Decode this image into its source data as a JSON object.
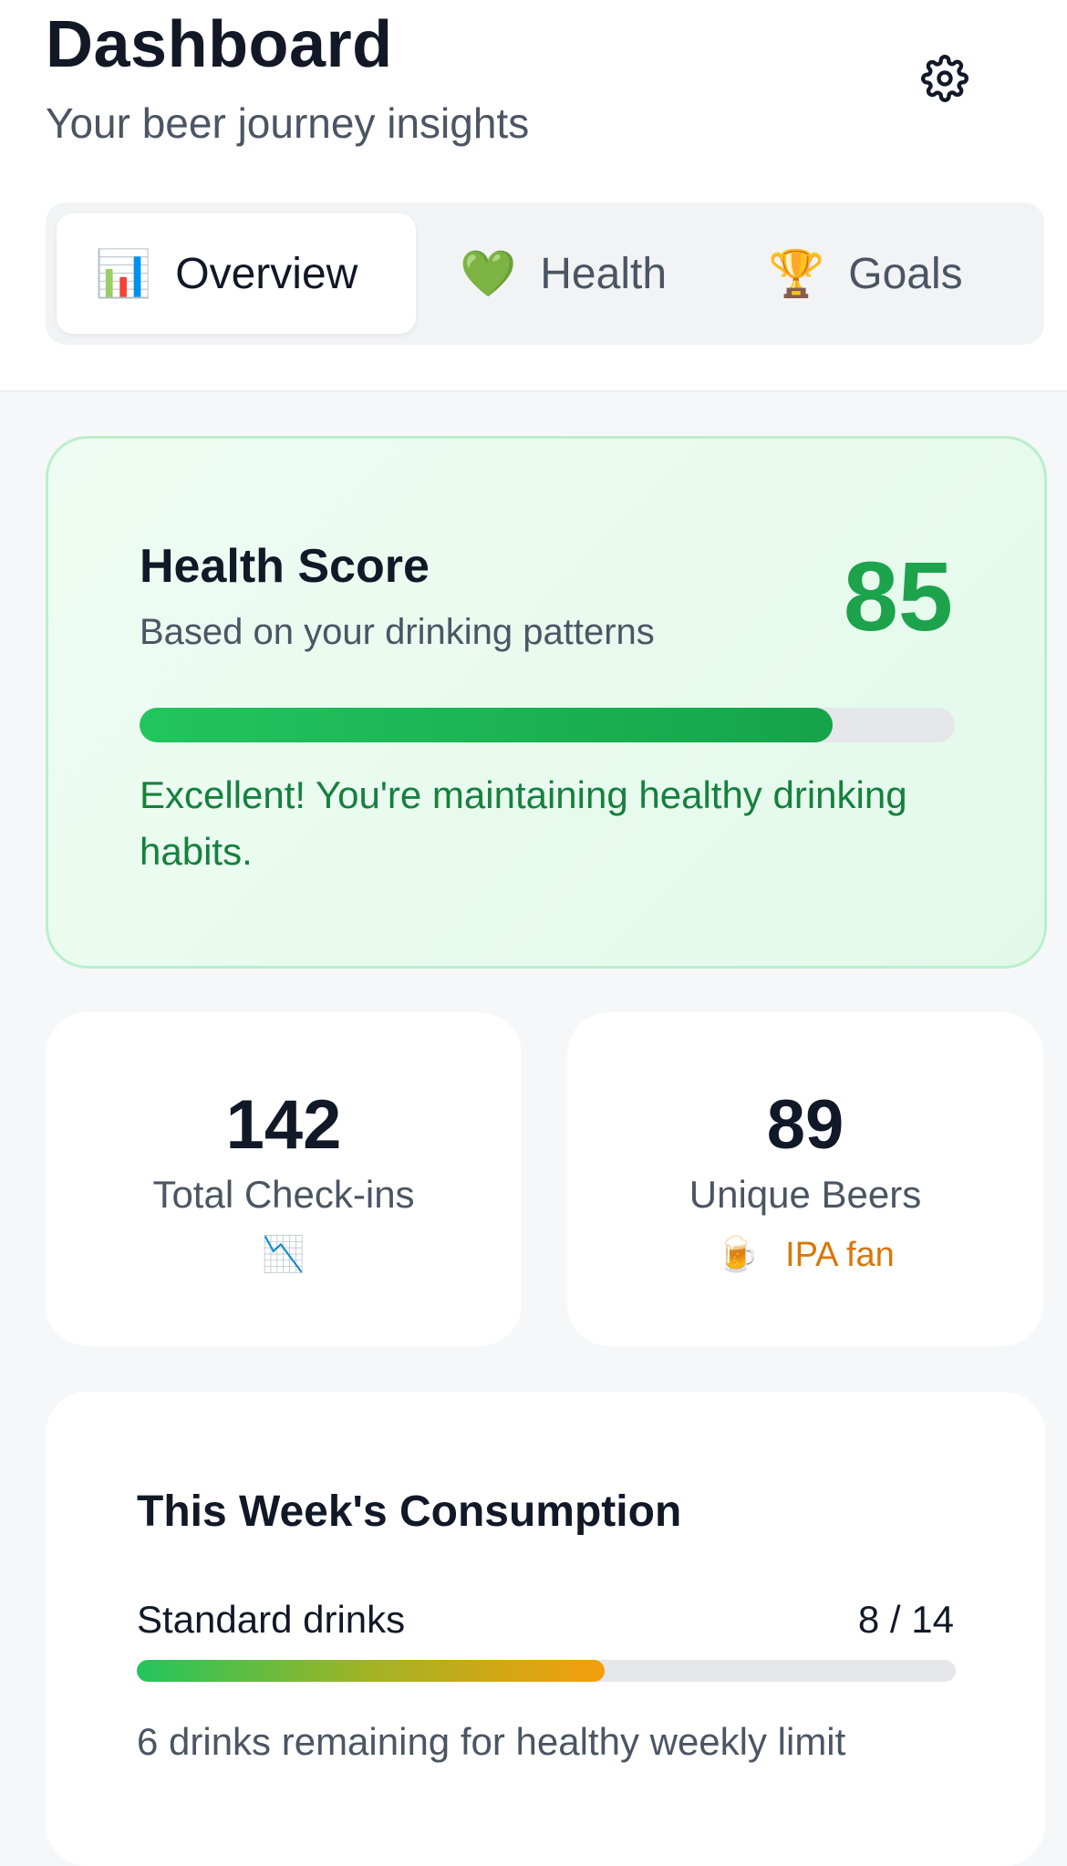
{
  "header": {
    "title": "Dashboard",
    "subtitle": "Your beer journey insights",
    "settings_icon": "gear-icon"
  },
  "tabs": [
    {
      "emoji": "📊",
      "label": "Overview",
      "active": true
    },
    {
      "emoji": "💚",
      "label": "Health",
      "active": false
    },
    {
      "emoji": "🏆",
      "label": "Goals",
      "active": false
    }
  ],
  "health_score": {
    "title": "Health Score",
    "subtitle": "Based on your drinking patterns",
    "score": "85",
    "progress_fraction": 0.85,
    "message": "Excellent! You're maintaining healthy drinking habits.",
    "accent": "#1ca34c"
  },
  "stats": [
    {
      "value": "142",
      "label": "Total Check-ins",
      "extra_icon": "📉",
      "extra_text": ""
    },
    {
      "value": "89",
      "label": "Unique Beers",
      "extra_icon": "🍺",
      "extra_text": "IPA fan",
      "extra_color": "#d97706"
    }
  ],
  "weekly": {
    "title": "This Week's Consumption",
    "label": "Standard drinks",
    "value_text": "8 / 14",
    "current": 8,
    "limit": 14,
    "note": "6 drinks remaining for healthy weekly limit"
  }
}
